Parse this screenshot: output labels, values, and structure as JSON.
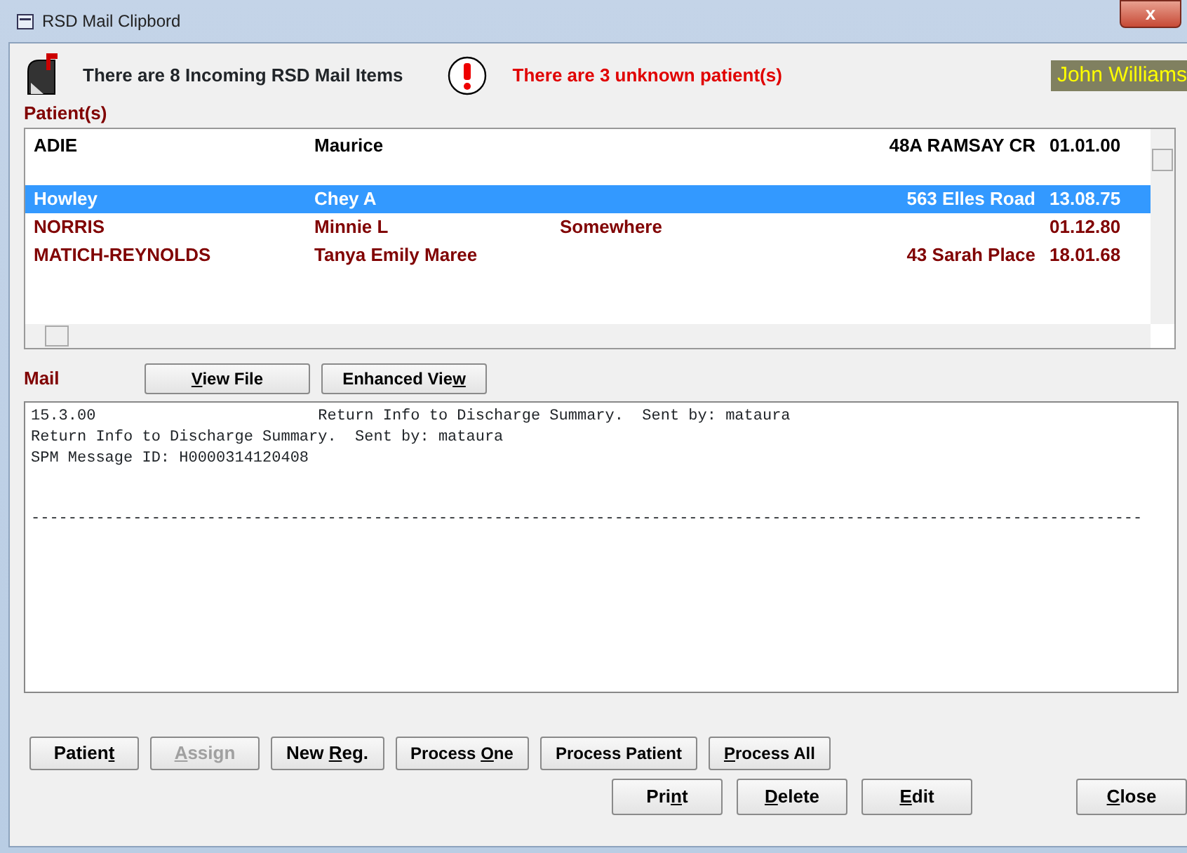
{
  "window": {
    "title": "RSD Mail Clipbord",
    "close_label": "x"
  },
  "header": {
    "incoming": "There are 8 Incoming RSD Mail Items",
    "unknown": "There are 3 unknown patient(s)",
    "user": "John Williams"
  },
  "patients": {
    "label": "Patient(s)",
    "rows": [
      {
        "surname": "ADIE",
        "first_names": "Maurice",
        "address": "48A RAMSAY CR",
        "dob": "01.01.00",
        "selected": false,
        "color": "#000000",
        "gap_after": true
      },
      {
        "surname": "Howley",
        "first_names": "Chey A",
        "address": "563 Elles Road",
        "dob": "13.08.75",
        "selected": true,
        "gap_after": false
      },
      {
        "surname": "NORRIS",
        "first_names": "Minnie L",
        "column_3": "Somewhere",
        "dob": "01.12.80",
        "selected": false,
        "color": "#800000",
        "gap_after": false
      },
      {
        "surname": "MATICH-REYNOLDS",
        "first_names": "Tanya  Emily Maree",
        "address": "43 Sarah Place",
        "dob": "18.01.68",
        "selected": false,
        "color": "#800000",
        "gap_after": false
      }
    ]
  },
  "mail": {
    "label": "Mail",
    "buttons": [
      {
        "access_key": "V",
        "text_after": "iew File",
        "disabled": false
      },
      {
        "text_before": "Enhanced Vie",
        "access_key": "w",
        "disabled": false
      }
    ],
    "lines": [
      "15.3.00                        Return Info to Discharge Summary.  Sent by: mataura",
      "Return Info to Discharge Summary.  Sent by: mataura",
      "SPM Message ID: H0000314120408"
    ],
    "rule": "------------------------------------------------------------------------------------------------------------------------"
  },
  "buttons_row_1": [
    {
      "text_before": "Patien",
      "access_key": "t",
      "disabled": false,
      "small": false
    },
    {
      "access_key": "A",
      "text_after": "ssign",
      "disabled": true,
      "small": false
    },
    {
      "text_before": "New ",
      "access_key": "R",
      "text_after": "eg.",
      "disabled": false,
      "small": false
    },
    {
      "text_before": "Process ",
      "access_key": "O",
      "text_after": "ne",
      "disabled": false,
      "small": true
    },
    {
      "text_before": "Process Patient",
      "disabled": false,
      "small": true
    },
    {
      "access_key": "P",
      "text_after": "rocess All",
      "disabled": false,
      "small": true
    }
  ],
  "buttons_row_2": [
    {
      "text_before": "Pri",
      "access_key": "n",
      "text_after": "t",
      "disabled": false,
      "small": false
    },
    {
      "access_key": "D",
      "text_after": "elete",
      "disabled": false,
      "small": false
    },
    {
      "access_key": "E",
      "text_after": "dit",
      "disabled": false,
      "small": false
    },
    {
      "access_key": "C",
      "text_after": "lose",
      "disabled": false,
      "small": false
    }
  ]
}
